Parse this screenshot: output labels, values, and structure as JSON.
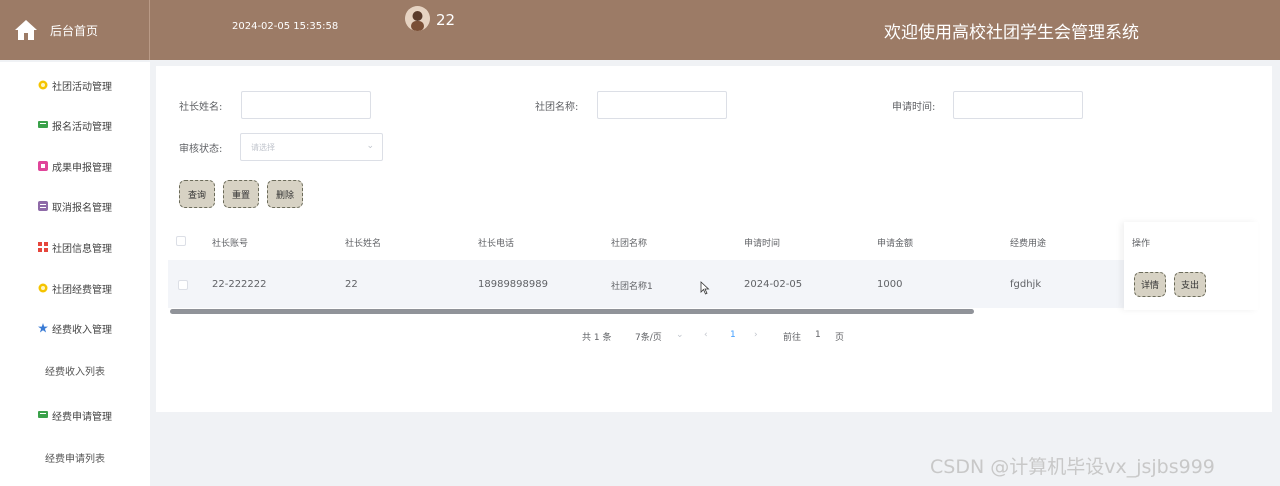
{
  "header": {
    "brand_label": "后台首页",
    "datetime": "2024-02-05 15:35:58",
    "username": "22",
    "system_title": "欢迎使用高校社团学生会管理系统",
    "colors": {
      "header_bg": "#9c7b66",
      "text": "#ffffff"
    }
  },
  "sidebar": {
    "items": [
      {
        "label": "社团活动管理",
        "icon": "sun-icon",
        "color": "#f5c400"
      },
      {
        "label": "报名活动管理",
        "icon": "message-icon",
        "color": "#3aa14a"
      },
      {
        "label": "成果申报管理",
        "icon": "gift-icon",
        "color": "#e0459a"
      },
      {
        "label": "取消报名管理",
        "icon": "list-icon",
        "color": "#8e6aa8"
      },
      {
        "label": "社团信息管理",
        "icon": "grid-icon",
        "color": "#e6463c"
      },
      {
        "label": "社团经费管理",
        "icon": "sun-icon",
        "color": "#f5c400"
      },
      {
        "label": "经费收入管理",
        "icon": "star-icon",
        "color": "#3a7bd5"
      },
      {
        "label": "经费收入列表",
        "icon": "",
        "color": ""
      },
      {
        "label": "经费申请管理",
        "icon": "message-icon",
        "color": "#3aa14a"
      },
      {
        "label": "经费申请列表",
        "icon": "",
        "color": ""
      }
    ]
  },
  "search": {
    "leader_name_label": "社长姓名:",
    "club_name_label": "社团名称:",
    "apply_time_label": "申请时间:",
    "review_status_label": "审核状态:",
    "review_status_placeholder": "请选择",
    "buttons": {
      "query": "查询",
      "reset": "重置",
      "delete": "删除"
    }
  },
  "table": {
    "headers": [
      "社长账号",
      "社长姓名",
      "社长电话",
      "社团名称",
      "申请时间",
      "申请金额",
      "经费用途",
      "操作"
    ],
    "rows": [
      {
        "account": "22-222222",
        "name": "22",
        "phone": "18989898989",
        "club": "社团名称1",
        "date": "2024-02-05",
        "amount": "1000",
        "purpose": "fgdhjk"
      }
    ],
    "row_actions": {
      "detail": "详情",
      "expense": "支出"
    }
  },
  "pagination": {
    "total": "共 1 条",
    "page_size": "7条/页",
    "current_page": "1",
    "goto_label": "前往",
    "goto_value": "1",
    "page_suffix": "页"
  },
  "watermark": "CSDN @计算机毕设vx_jsjbs999"
}
